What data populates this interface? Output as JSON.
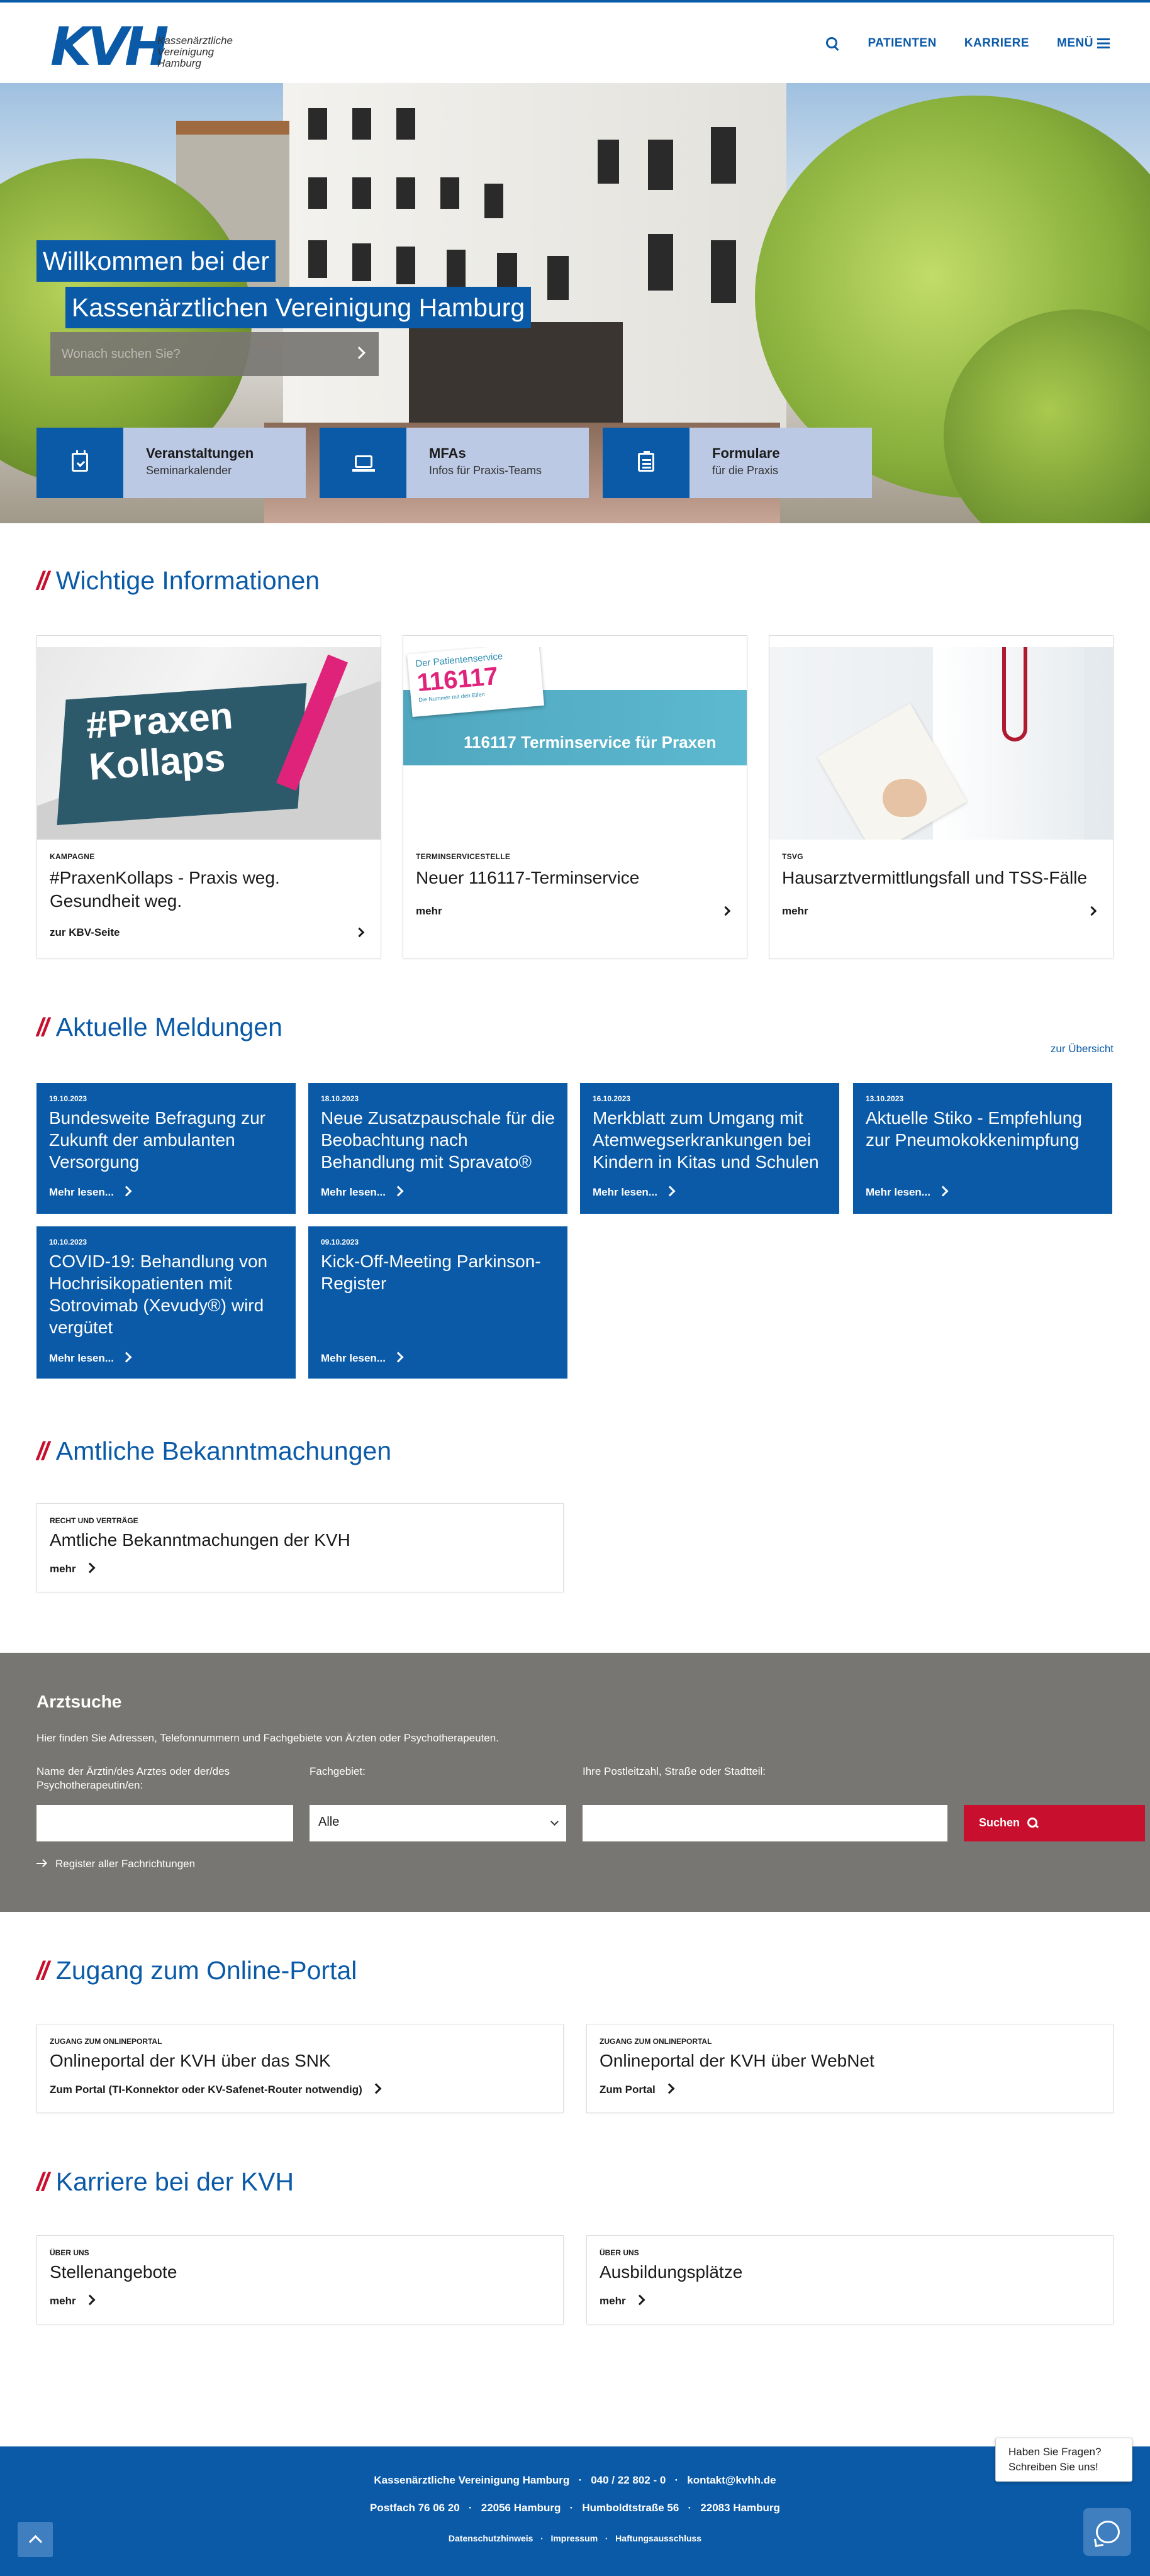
{
  "header": {
    "logo_letters": "KVH",
    "logo_lines": [
      "Kassenärztliche",
      "Vereinigung",
      "Hamburg"
    ],
    "nav": {
      "patienten": "PATIENTEN",
      "karriere": "KARRIERE",
      "menu": "MENÜ"
    }
  },
  "hero": {
    "line1": "Willkommen bei der",
    "line2": "Kassenärztlichen Vereinigung Hamburg",
    "search_placeholder": "Wonach suchen Sie?",
    "tiles": [
      {
        "title": "Veranstaltungen",
        "sub": "Seminarkalender"
      },
      {
        "title": "MFAs",
        "sub": "Infos für Praxis-Teams"
      },
      {
        "title": "Formulare",
        "sub": "für die Praxis"
      }
    ]
  },
  "wichtige": {
    "slash": "//",
    "title": "Wichtige Informationen",
    "cards": [
      {
        "tag": "KAMPAGNE",
        "title": "#PraxenKollaps - Praxis weg. Gesundheit weg.",
        "link": "zur KBV-Seite",
        "image_text": [
          "#Praxen",
          "Kollaps"
        ]
      },
      {
        "tag": "TERMINSERVICESTELLE",
        "title": "Neuer 116117-Terminservice",
        "link": "mehr",
        "image_text": [
          "Der Patientenservice",
          "116117",
          "Die Nummer mit den Elfen",
          "116117 Terminservice für Praxen"
        ]
      },
      {
        "tag": "TSVG",
        "title": "Hausarztvermittlungsfall und TSS-Fälle",
        "link": "mehr"
      }
    ]
  },
  "meldungen": {
    "slash": "//",
    "title": "Aktuelle Meldungen",
    "overview": "zur Übersicht",
    "items": [
      {
        "date": "19.10.2023",
        "title": "Bundesweite Befragung zur Zukunft der ambulanten Versorgung",
        "more": "Mehr lesen..."
      },
      {
        "date": "18.10.2023",
        "title": "Neue Zusatzpauschale für die Beobachtung nach Behandlung mit Spravato®",
        "more": "Mehr lesen..."
      },
      {
        "date": "16.10.2023",
        "title": "Merkblatt zum Umgang mit Atemwegserkrankungen bei Kindern in Kitas und Schulen",
        "more": "Mehr lesen..."
      },
      {
        "date": "13.10.2023",
        "title": "Aktuelle Stiko - Empfehlung zur Pneumokokkenimpfung",
        "more": "Mehr lesen..."
      },
      {
        "date": "10.10.2023",
        "title": "COVID-19: Behandlung von Hochrisikopatienten mit Sotrovimab (Xevudy®) wird vergütet",
        "more": "Mehr lesen..."
      },
      {
        "date": "09.10.2023",
        "title": "Kick-Off-Meeting Parkinson-Register",
        "more": "Mehr lesen..."
      }
    ]
  },
  "amtliche": {
    "slash": "//",
    "title": "Amtliche Bekanntmachungen",
    "card": {
      "tag": "RECHT UND VERTRÄGE",
      "title": "Amtliche Bekanntmachungen der KVH",
      "link": "mehr"
    }
  },
  "arztsuche": {
    "heading": "Arztsuche",
    "desc": "Hier finden Sie Adressen, Telefonnummern und Fachgebiete von Ärzten oder Psychotherapeuten.",
    "label_name": "Name der Ärztin/des Arztes oder der/des Psychotherapeutin/en:",
    "label_fach": "Fachgebiet:",
    "fach_value": "Alle",
    "label_ort": "Ihre Postleitzahl, Straße oder Stadtteil:",
    "button": "Suchen",
    "register": "Register aller Fachrichtungen"
  },
  "portal": {
    "slash": "//",
    "title": "Zugang zum Online-Portal",
    "cards": [
      {
        "tag": "ZUGANG ZUM ONLINEPORTAL",
        "title": "Onlineportal der KVH über das SNK",
        "link": "Zum Portal (TI-Konnektor oder KV-Safenet-Router notwendig)"
      },
      {
        "tag": "ZUGANG ZUM ONLINEPORTAL",
        "title": "Onlineportal der KVH über WebNet",
        "link": "Zum Portal"
      }
    ]
  },
  "karriere": {
    "slash": "//",
    "title": "Karriere bei der KVH",
    "cards": [
      {
        "tag": "ÜBER UNS",
        "title": "Stellenangebote",
        "link": "mehr"
      },
      {
        "tag": "ÜBER UNS",
        "title": "Ausbildungsplätze",
        "link": "mehr"
      }
    ]
  },
  "footer": {
    "line1": "Kassenärztliche Vereinigung Hamburg   ·   040 / 22 802 - 0   ·   kontakt@kvhh.de",
    "line2": "Postfach 76 06 20   ·   22056 Hamburg   ·   Humboldtstraße 56   ·   22083 Hamburg",
    "line3": "Datenschutzhinweis   ·   Impressum   ·   Haftungsausschluss"
  },
  "chat": {
    "line1": "Haben Sie Fragen?",
    "line2": "Schreiben Sie uns!"
  },
  "colors": {
    "brand_blue": "#0a5aa8",
    "accent_red": "#c8102e",
    "tile_light": "#bcc9e4",
    "search_band": "#787672"
  }
}
